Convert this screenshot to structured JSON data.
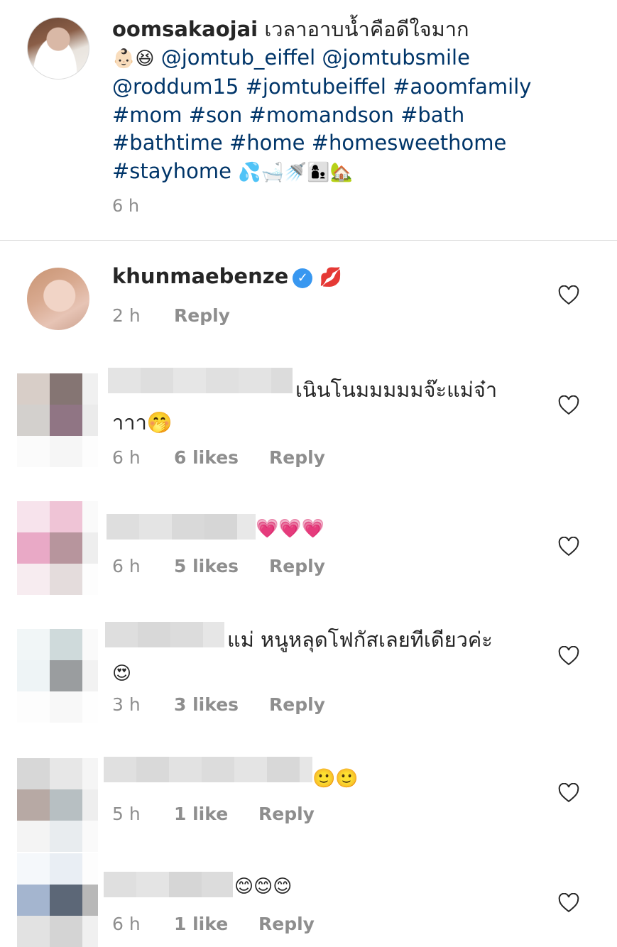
{
  "caption": {
    "username": "oomsakaojai",
    "text_thai": "เวลาอาบน้ำคือดีใจมาก",
    "line2_emoji": "👶🏻😆",
    "mentions": [
      "@jomtub_eiffel",
      "@jomtubsmile",
      "@roddum15"
    ],
    "hashtags": [
      "#jomtubeiffel",
      "#aoomfamily",
      "#mom",
      "#son",
      "#momandson",
      "#bath",
      "#bathtime",
      "#home",
      "#homesweethome",
      "#stayhome"
    ],
    "trailing_emoji": "💦🛁🚿👩‍👦🏡",
    "time": "6 h"
  },
  "comments": [
    {
      "username": "khunmaebenze",
      "verified": true,
      "text": "💋",
      "time": "2 h",
      "likes": "",
      "reply": "Reply"
    },
    {
      "username": "",
      "text_line1": "เนินโนมมมมมจ๊ะแม่จ๋า",
      "text_line2": "าาา🤭",
      "time": "6 h",
      "likes": "6 likes",
      "reply": "Reply"
    },
    {
      "username": "",
      "text": "💗💗💗",
      "time": "6 h",
      "likes": "5 likes",
      "reply": "Reply"
    },
    {
      "username": "",
      "text_line1": "แม่ หนูหลุดโฟกัสเลยทีเดียวค่ะ",
      "text_line2": "😍",
      "time": "3 h",
      "likes": "3 likes",
      "reply": "Reply"
    },
    {
      "username": "",
      "text": "🙂🙂",
      "time": "5 h",
      "likes": "1 like",
      "reply": "Reply"
    },
    {
      "username": "",
      "text": "😊😊😊",
      "time": "6 h",
      "likes": "1 like",
      "reply": "Reply"
    }
  ],
  "icons": {
    "heart": "heart-outline-icon",
    "verified": "verified-badge-icon"
  },
  "colors": {
    "link": "#003569",
    "muted": "#8e8e8e",
    "verified": "#3897f0",
    "divider": "#dbdbdb"
  }
}
